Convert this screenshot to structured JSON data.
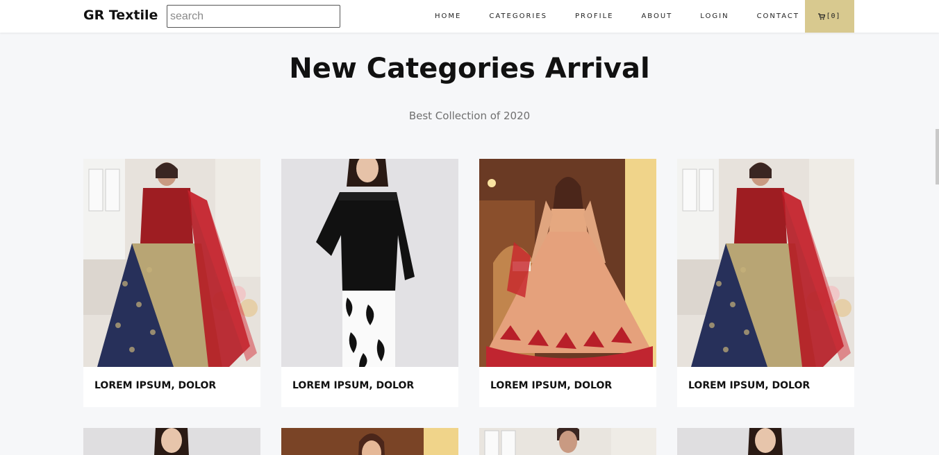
{
  "navbar": {
    "brand": "GR Textile",
    "search_placeholder": "search",
    "menu": [
      "HOME",
      "CATEGORIES",
      "PROFILE",
      "ABOUT",
      "LOGIN",
      "CONTACT"
    ],
    "cart_label": "[0]",
    "cart_icon": "cart-icon"
  },
  "hero": {
    "title": "New Categories Arrival",
    "subtitle": "Best Collection of 2020"
  },
  "products": [
    {
      "caption": "LOREM IPSUM, DOLOR",
      "image": "red-navy-lehenga-photo"
    },
    {
      "caption": "LOREM IPSUM, DOLOR",
      "image": "girl-black-kurti-photo"
    },
    {
      "caption": "LOREM IPSUM, DOLOR",
      "image": "bridal-lehenga-photo"
    },
    {
      "caption": "LOREM IPSUM, DOLOR",
      "image": "red-navy-lehenga-photo"
    }
  ],
  "products_row2": [
    "girl-portrait-photo",
    "bridal-portrait-photo",
    "lehenga-portrait-photo",
    "girl-portrait-photo"
  ],
  "colors": {
    "cart_bg": "#d8c98f",
    "page_bg": "#f6f7f9"
  }
}
